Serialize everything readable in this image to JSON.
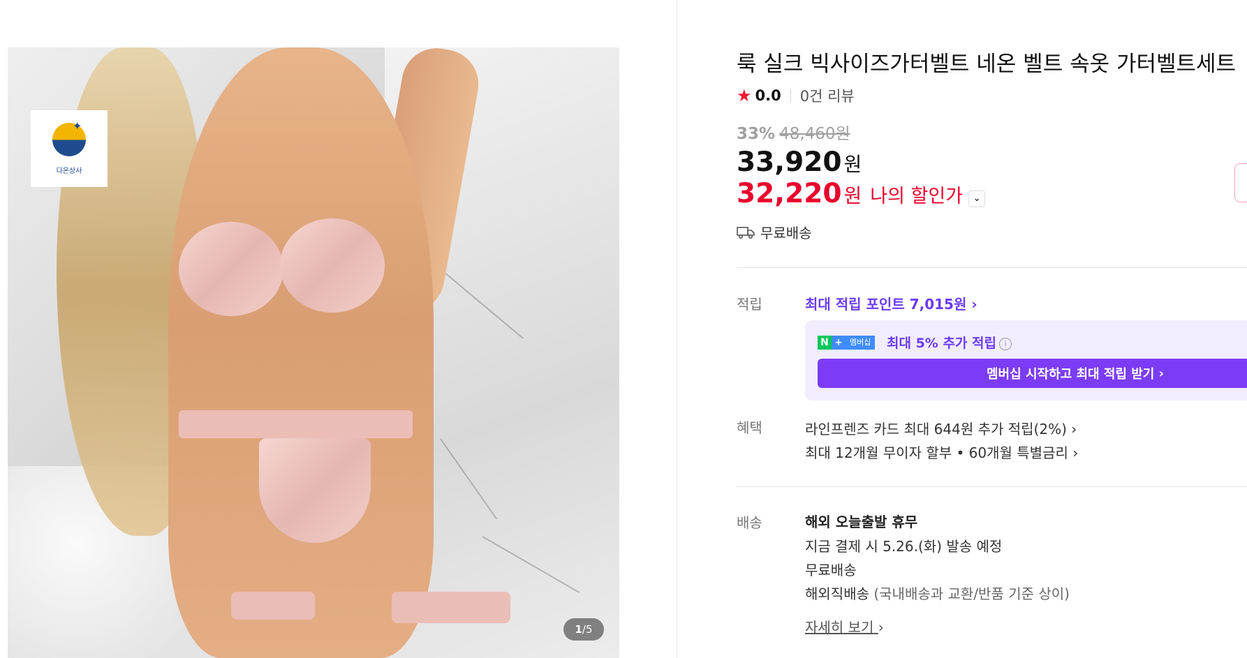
{
  "product": {
    "title": "룩 실크 빅사이즈가터벨트 네온 벨트 속옷 가터벨트세트",
    "rating": "0.0",
    "review_count": "0건 리뷰",
    "discount_rate": "33%",
    "original_price": "48,460원",
    "price": "33,920",
    "price_unit": "원",
    "my_price": "32,220",
    "my_price_unit": "원",
    "my_price_label": "나의 할인가",
    "shipping_summary": "무료배송"
  },
  "image": {
    "logo_text": "다온상사",
    "pager_current": "1",
    "pager_total": "/5"
  },
  "points": {
    "label": "적립",
    "max_points": "최대 적립 포인트 7,015원",
    "membership_badge": "멤버십",
    "extra_text": "최대 5% 추가 적립",
    "membership_button": "멤버십 시작하고 최대 적립 받기"
  },
  "benefits": {
    "label": "혜택",
    "items": [
      "라인프렌즈 카드 최대 644원 추가 적립(2%)",
      "최대 12개월 무이자 할부 • 60개월 특별금리"
    ]
  },
  "delivery": {
    "label": "배송",
    "headline": "해외 오늘출발 휴무",
    "lines": [
      "지금 결제 시 5.26.(화) 발송 예정",
      "무료배송"
    ],
    "overseas": "해외직배송",
    "overseas_note": "(국내배송과 교환/반품 기준 상이)",
    "more_link": "자세히 보기"
  },
  "colors": {
    "accent_red": "#ea002c",
    "accent_purple": "#6a3cf7",
    "membership_bg": "#f1edff"
  }
}
